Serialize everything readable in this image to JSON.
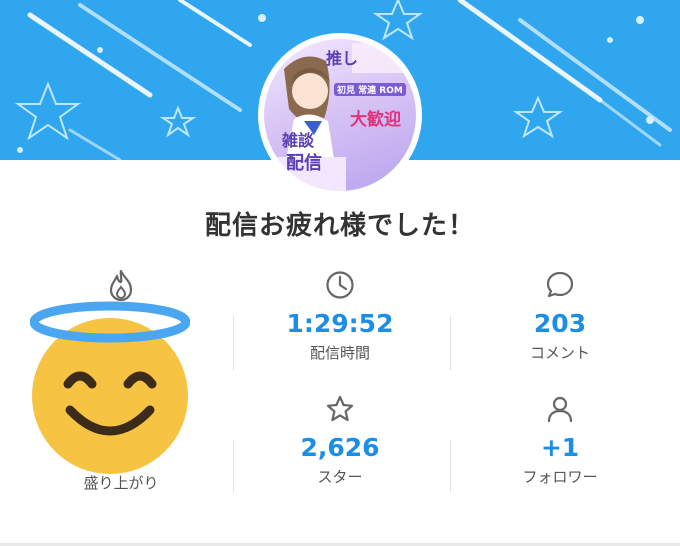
{
  "avatar": {
    "line1": "推し",
    "line2": "初見 常連 ROM",
    "line3": "大歓迎",
    "line4": "雑談",
    "line5": "配信"
  },
  "header": {
    "title": "配信お疲れ様でした！"
  },
  "stats": [
    {
      "icon": "flame-icon",
      "value": "",
      "label": "盛り上がり"
    },
    {
      "icon": "clock-icon",
      "value": "1:29:52",
      "label": "配信時間"
    },
    {
      "icon": "comment-icon",
      "value": "203",
      "label": "コメント"
    },
    {
      "icon": "star-icon",
      "value": "2,626",
      "label": "スター"
    },
    {
      "icon": "person-icon",
      "value": "+1",
      "label": "フォロワー"
    }
  ],
  "colors": {
    "banner": "#2fa6ee",
    "value": "#1c8ee3",
    "emoji_face": "#f6c342",
    "halo": "#4aa6f0"
  }
}
